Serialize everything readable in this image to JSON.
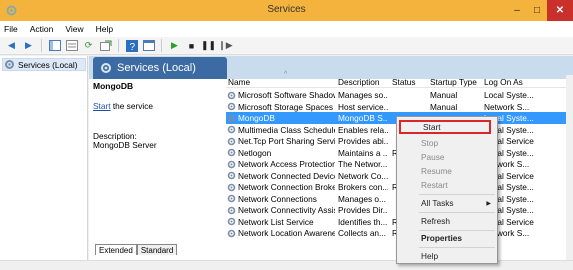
{
  "window": {
    "title": "Services",
    "minimize": "–",
    "maximize": "□",
    "close": "✕"
  },
  "menu": [
    "File",
    "Action",
    "View",
    "Help"
  ],
  "tree": {
    "item": "Services (Local)"
  },
  "header": {
    "title": "Services (Local)"
  },
  "detail": {
    "service_name": "MongoDB",
    "start_link": "Start",
    "start_suffix": " the service",
    "description_label": "Description:",
    "description": "MongoDB Server"
  },
  "columns": [
    "Name",
    "Description",
    "Status",
    "Startup Type",
    "Log On As"
  ],
  "rows": [
    {
      "name": "Microsoft Software Shadow...",
      "description": "Manages so...",
      "status": "",
      "startup": "Manual",
      "logon": "Local Syste..."
    },
    {
      "name": "Microsoft Storage Spaces S...",
      "description": "Host service...",
      "status": "",
      "startup": "Manual",
      "logon": "Network S..."
    },
    {
      "name": "MongoDB",
      "description": "MongoDB S...",
      "status": "",
      "startup": "",
      "logon": "Local Syste..."
    },
    {
      "name": "Multimedia Class Scheduler",
      "description": "Enables rela...",
      "status": "",
      "startup": "",
      "logon": "Local Syste..."
    },
    {
      "name": "Net.Tcp Port Sharing Service",
      "description": "Provides abi...",
      "status": "",
      "startup": "",
      "logon": "Local Service"
    },
    {
      "name": "Netlogon",
      "description": "Maintains a ...",
      "status": "Ru",
      "startup": "",
      "logon": "Local Syste..."
    },
    {
      "name": "Network Access Protection ...",
      "description": "The Networ...",
      "status": "",
      "startup": "",
      "logon": "Network S..."
    },
    {
      "name": "Network Connected Device...",
      "description": "Network Co...",
      "status": "",
      "startup": "",
      "logon": "Local Service"
    },
    {
      "name": "Network Connection Broker",
      "description": "Brokers con...",
      "status": "Ru",
      "startup": "",
      "logon": "Local Syste..."
    },
    {
      "name": "Network Connections",
      "description": "Manages o...",
      "status": "",
      "startup": "",
      "logon": "Local Syste..."
    },
    {
      "name": "Network Connectivity Assis...",
      "description": "Provides Dir...",
      "status": "",
      "startup": "",
      "logon": "Local Syste..."
    },
    {
      "name": "Network List Service",
      "description": "Identifies th...",
      "status": "Ru",
      "startup": "",
      "logon": "Local Service"
    },
    {
      "name": "Network Location Awareness",
      "description": "Collects an...",
      "status": "Ru",
      "startup": "",
      "logon": "Network S..."
    }
  ],
  "context_menu": {
    "start": "Start",
    "stop": "Stop",
    "pause": "Pause",
    "resume": "Resume",
    "restart": "Restart",
    "all_tasks": "All Tasks",
    "refresh": "Refresh",
    "properties": "Properties",
    "help": "Help"
  },
  "tabs": [
    "Extended",
    "Standard"
  ],
  "colors": {
    "titlebar": "#f3b33d",
    "close": "#c9302c",
    "selection": "#3399ff",
    "highlight": "#d8262b",
    "header": "#3c6aa2"
  }
}
